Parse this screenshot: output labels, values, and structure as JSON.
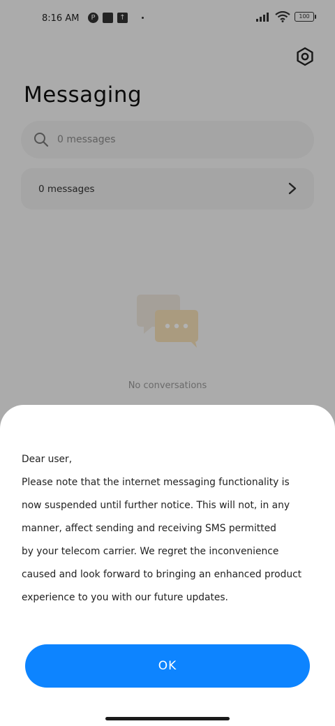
{
  "status_bar": {
    "time": "8:16 AM",
    "battery": "100"
  },
  "header": {
    "title": "Messaging"
  },
  "search": {
    "placeholder": "0 messages"
  },
  "row": {
    "label": "0 messages"
  },
  "empty_state": {
    "text": "No conversations"
  },
  "dialog": {
    "greeting": "Dear user,",
    "body_lines": [
      "Please note that the internet messaging functionality is",
      "now suspended until further notice. This will not, in any",
      "manner, affect sending and receiving SMS permitted",
      "by your telecom carrier. We regret the inconvenience",
      "caused and look forward to bringing an enhanced product",
      "experience to you with our future updates."
    ],
    "ok_label": "OK"
  },
  "colors": {
    "accent": "#0d84ff",
    "scrim": "rgba(0,0,0,0.30)"
  },
  "icons": [
    "settings-icon",
    "search-icon",
    "chevron-right-icon",
    "chat-bubbles-icon",
    "wifi-icon",
    "signal-icon",
    "battery-icon"
  ]
}
